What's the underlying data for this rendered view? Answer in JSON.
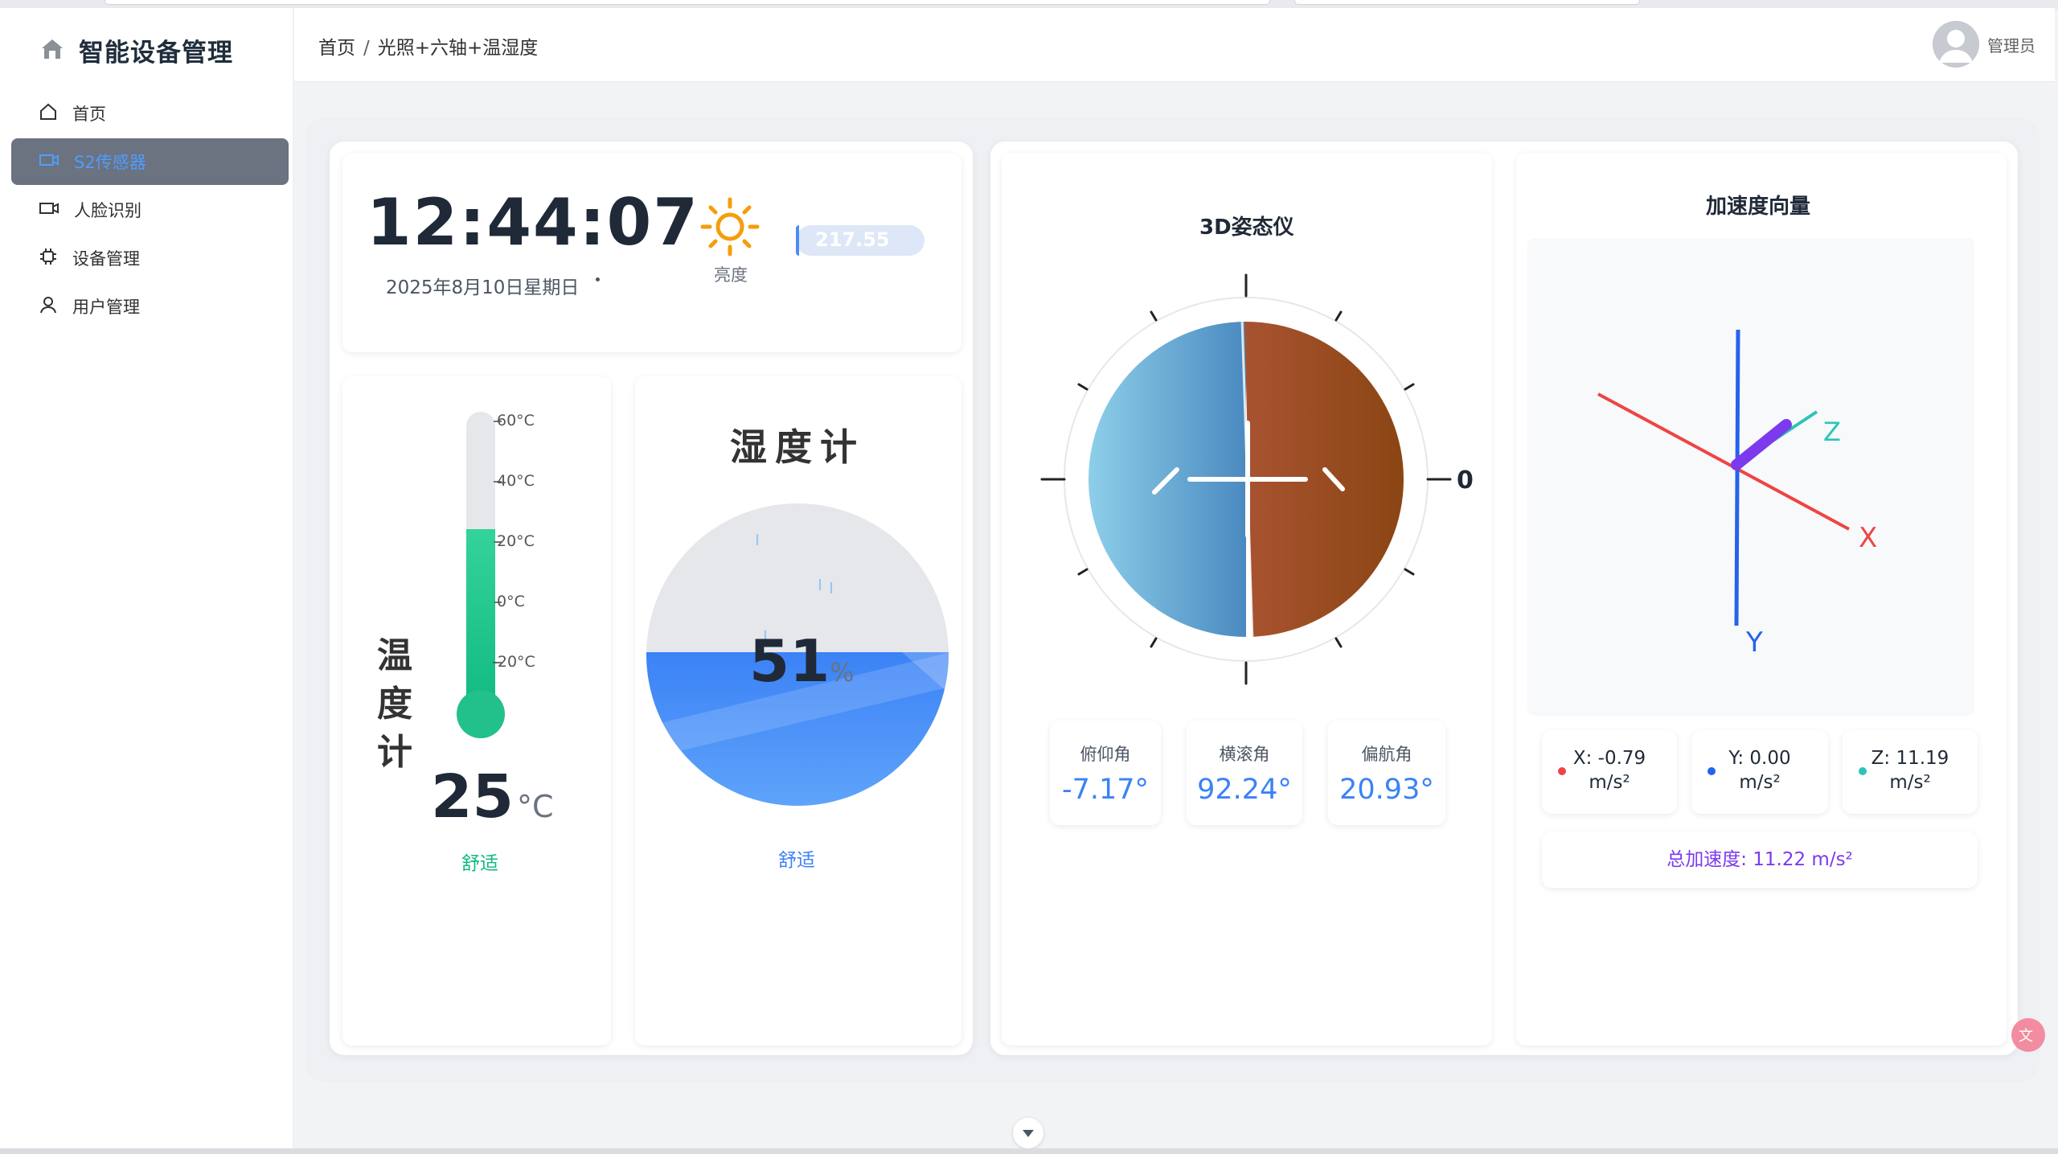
{
  "sidebar": {
    "brand": "智能设备管理",
    "items": [
      {
        "label": "首页",
        "icon": "home-icon"
      },
      {
        "label": "S2传感器",
        "icon": "camera-icon",
        "active": true
      },
      {
        "label": "人脸识别",
        "icon": "video-icon"
      },
      {
        "label": "设备管理",
        "icon": "chip-icon"
      },
      {
        "label": "用户管理",
        "icon": "user-icon"
      }
    ]
  },
  "header": {
    "breadcrumb": [
      "首页",
      "光照+六轴+温湿度"
    ],
    "separator": "/",
    "user_name": "管理员"
  },
  "clock": {
    "time": "12:44:07",
    "date": "2025年8月10日星期日"
  },
  "brightness": {
    "label": "亮度",
    "value": "217.55",
    "icon": "sun-icon"
  },
  "thermometer": {
    "title": "温度计",
    "title_chars": [
      "温",
      "度",
      "计"
    ],
    "ticks": [
      "60°C",
      "40°C",
      "20°C",
      "0°C",
      "-20°C"
    ],
    "value": "25",
    "unit": "°C",
    "value_number": 25,
    "status": "舒适",
    "color": "#34d399"
  },
  "hygrometer": {
    "title": "湿度计",
    "value": "51",
    "unit": "%",
    "value_number": 51,
    "status": "舒适",
    "color": "#3b82f6"
  },
  "attitude": {
    "title": "3D姿态仪",
    "zero_label": "0",
    "stats": [
      {
        "label": "俯仰角",
        "value": "-7.17°"
      },
      {
        "label": "横滚角",
        "value": "92.24°"
      },
      {
        "label": "偏航角",
        "value": "20.93°"
      }
    ],
    "sky_color": "#5a9cd0",
    "ground_color": "#9a4a1c"
  },
  "acceleration": {
    "title": "加速度向量",
    "axes": {
      "x": "X",
      "y": "Y",
      "z": "Z"
    },
    "cards": [
      {
        "line1": "X: -0.79",
        "line2": "m/s²",
        "color": "#ef4444"
      },
      {
        "line1": "Y: 0.00",
        "line2": "m/s²",
        "color": "#2563eb"
      },
      {
        "line1": "Z: 11.19",
        "line2": "m/s²",
        "color": "#2ec4b6"
      }
    ],
    "total": "总加速度: 11.22 m/s²"
  }
}
